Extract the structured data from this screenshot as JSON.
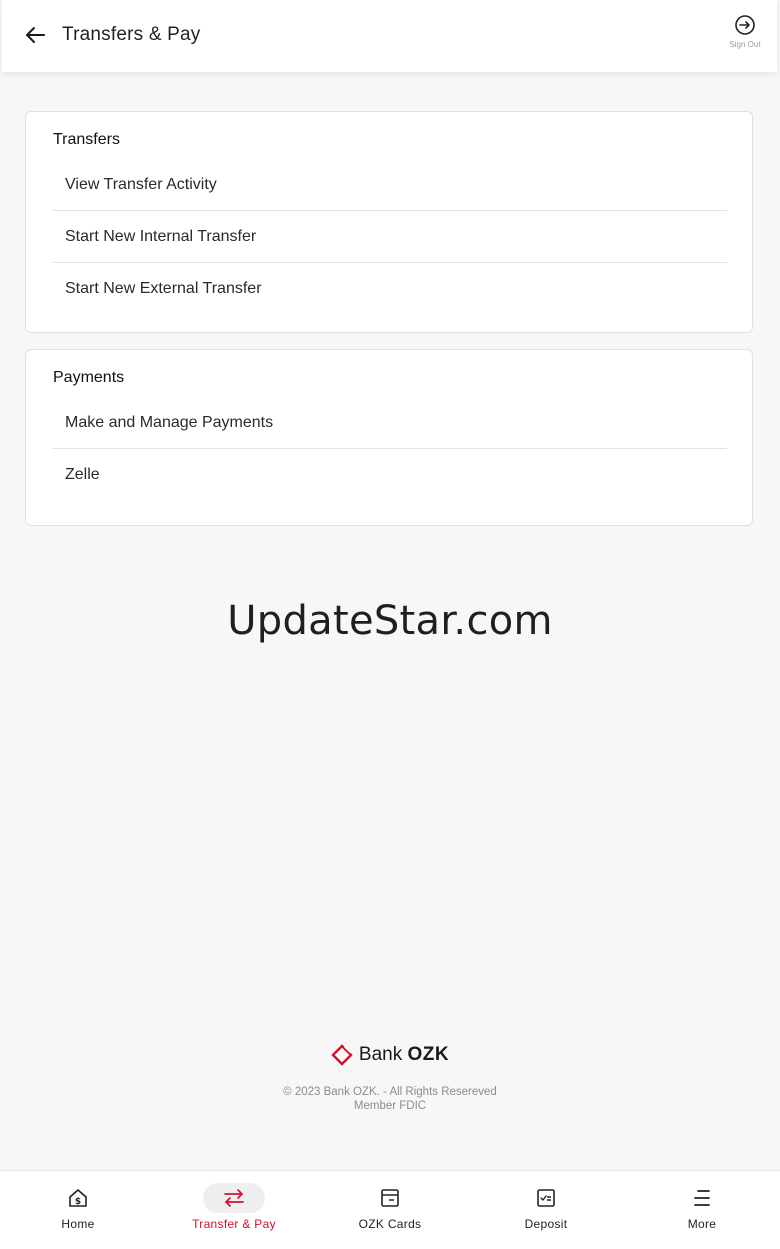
{
  "header": {
    "title": "Transfers & Pay",
    "back_icon": "arrow-left-icon",
    "sign_out_label": "Sign Out",
    "sign_out_icon": "sign-out-icon"
  },
  "transfers": {
    "title": "Transfers",
    "items": [
      {
        "label": "View Transfer Activity"
      },
      {
        "label": "Start New Internal Transfer"
      },
      {
        "label": "Start New External Transfer"
      }
    ]
  },
  "payments": {
    "title": "Payments",
    "items": [
      {
        "label": "Make and Manage Payments"
      },
      {
        "label": "Zelle"
      }
    ]
  },
  "watermark": "UpdateStar.com",
  "footer": {
    "brand_prefix": "Bank",
    "brand_name": "OZK",
    "copyright": "© 2023 Bank OZK. - All Rights Resereved",
    "fdic": "Member FDIC"
  },
  "tabbar": {
    "tabs": [
      {
        "label": "Home",
        "icon": "home-dollar-icon"
      },
      {
        "label": "Transfer & Pay",
        "icon": "transfer-arrows-icon",
        "active": true
      },
      {
        "label": "OZK Cards",
        "icon": "card-icon"
      },
      {
        "label": "Deposit",
        "icon": "check-deposit-icon"
      },
      {
        "label": "More",
        "icon": "menu-icon"
      }
    ]
  },
  "colors": {
    "accent": "#d0142c",
    "background": "#f7f7f7",
    "card": "#ffffff"
  }
}
